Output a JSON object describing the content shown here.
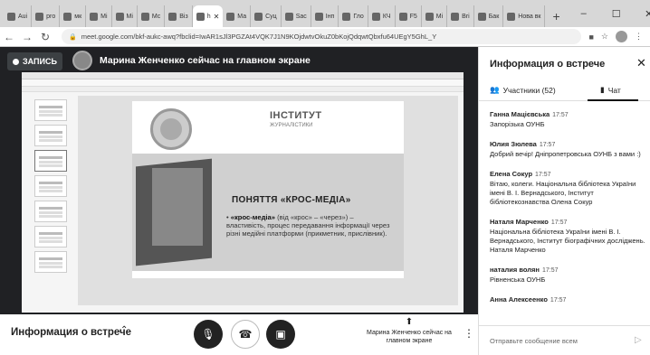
{
  "browser": {
    "tabs": [
      {
        "label": "Aui"
      },
      {
        "label": "pro"
      },
      {
        "label": "мк"
      },
      {
        "label": "Mi"
      },
      {
        "label": "Mi"
      },
      {
        "label": "Mc"
      },
      {
        "label": "Biз"
      },
      {
        "label": "h",
        "active": true
      },
      {
        "label": "Ма"
      },
      {
        "label": "Cyц"
      },
      {
        "label": "Sac"
      },
      {
        "label": "Інп"
      },
      {
        "label": "Гло"
      },
      {
        "label": "КЧ"
      },
      {
        "label": "F5"
      },
      {
        "label": "Mi"
      },
      {
        "label": "Bri"
      },
      {
        "label": "Бак"
      },
      {
        "label": "Нова вк"
      }
    ],
    "new_tab": "+",
    "url": "meet.google.com/bkf-aukc-awq?fbclid=IwAR1sJl3PGZAt4VQK7J1N9KOjdwtvOkuZ0bKojQdqwtQbxfu64UEgY5GhL_Y"
  },
  "meeting": {
    "recording_label": "ЗАПИСЬ",
    "presenter_text": "Марина Женченко сейчас на главном экране"
  },
  "slide": {
    "logo_title": "ІНСТИТУТ",
    "logo_subtitle": "ЖУРНАЛІСТИКИ",
    "title": "ПОНЯТТЯ «КРОС-МЕДІА»",
    "term": "«крос-медіа»",
    "body": " (від «крос» – «через») – властивість, процес передавання інформації через різні медійні платформи (прикметник, прислівник)."
  },
  "side_panel": {
    "title": "Информация о встрече",
    "participants_tab": "Участники (52)",
    "chat_tab": "Чат",
    "messages": [
      {
        "name": "Ганна Мацієвська",
        "time": "17:57",
        "text": "Запорізька ОУНБ"
      },
      {
        "name": "Юлия Зюлева",
        "time": "17:57",
        "text": "Добрий вечір! Дніпропетровська ОУНБ з вами :)"
      },
      {
        "name": "Елена Сокур",
        "time": "17:57",
        "text": "Вітаю, колеги. Національна бібліотека України імені В. І. Вернадського, Інститут бібліотекознавства Олена Сокур"
      },
      {
        "name": "Наталя Марченко",
        "time": "17:57",
        "text": "Національна бібліотека України імені В. І. Вернадського, Інститут біографічних досліджень. Наталя Марченко"
      },
      {
        "name": "наталия волян",
        "time": "17:57",
        "text": "Рівненська ОУНБ"
      },
      {
        "name": "Анна Алексеенко",
        "time": "17:57",
        "text": ""
      }
    ],
    "input_placeholder": "Отправьте сообщение всем"
  },
  "bottom": {
    "meeting_info_label": "Информация о встрече",
    "present_label": "Марина Женченко сейчас на главном экране"
  }
}
